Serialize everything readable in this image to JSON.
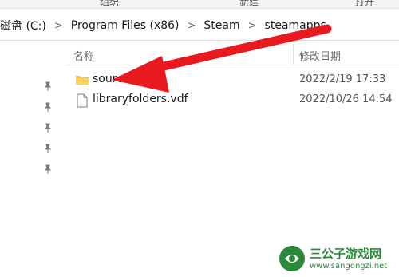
{
  "ribbon": {
    "items": [
      "组织",
      "新建",
      "打开"
    ]
  },
  "breadcrumb": {
    "items": [
      "磁盘 (C:)",
      "Program Files (x86)",
      "Steam",
      "steamapps"
    ]
  },
  "columns": {
    "name": "名称",
    "modified": "修改日期"
  },
  "files": [
    {
      "name": "sourcemods",
      "date": "2022/2/19 17:33",
      "type": "folder"
    },
    {
      "name": "libraryfolders.vdf",
      "date": "2022/10/26 14:54",
      "type": "file"
    }
  ],
  "watermark": {
    "title": "三公子游戏网",
    "url": "www.sangongzi.net"
  },
  "colors": {
    "arrow": "#e8191f",
    "folder": "#f6c243",
    "watermark": "#2a8a3a"
  }
}
